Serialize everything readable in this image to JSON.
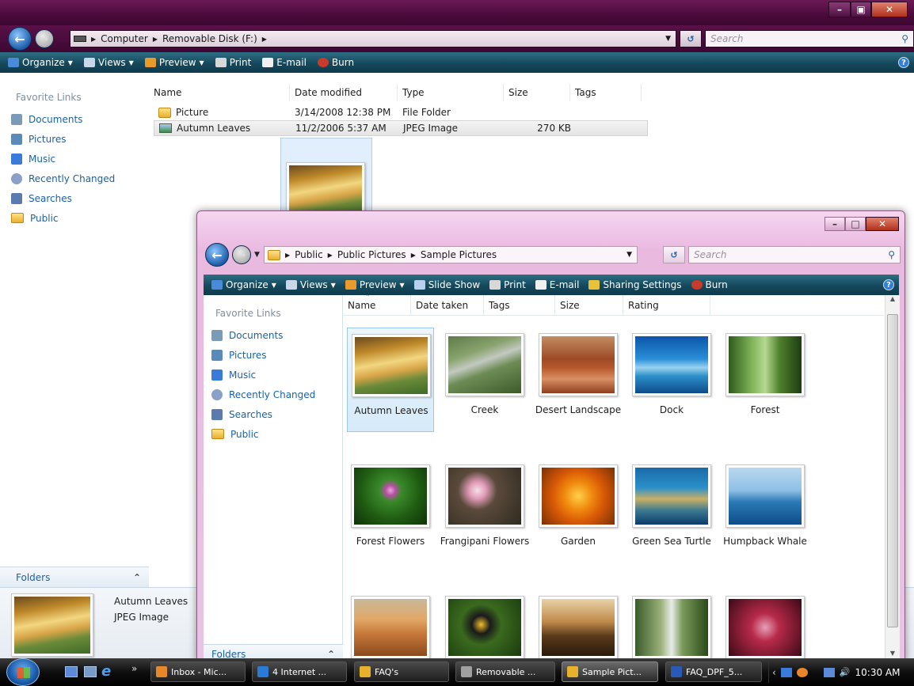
{
  "back_window": {
    "title": "Removable Disk",
    "breadcrumb": [
      "Computer",
      "Removable Disk (F:)"
    ],
    "search_placeholder": "Search",
    "toolbar": [
      {
        "label": "Organize",
        "icon": "organize-icon",
        "dropdown": true
      },
      {
        "label": "Views",
        "icon": "views-icon",
        "dropdown": true
      },
      {
        "label": "Preview",
        "icon": "preview-icon",
        "dropdown": true
      },
      {
        "label": "Print",
        "icon": "print-icon"
      },
      {
        "label": "E-mail",
        "icon": "email-icon"
      },
      {
        "label": "Burn",
        "icon": "burn-icon"
      }
    ],
    "favorite_links_title": "Favorite Links",
    "favorite_links": [
      "Documents",
      "Pictures",
      "Music",
      "Recently Changed",
      "Searches",
      "Public"
    ],
    "columns": [
      "Name",
      "Date modified",
      "Type",
      "Size",
      "Tags"
    ],
    "files": [
      {
        "name": "Picture",
        "date": "3/14/2008 12:38 PM",
        "type": "File Folder",
        "size": ""
      },
      {
        "name": "Autumn Leaves",
        "date": "11/2/2006 5:37 AM",
        "type": "JPEG Image",
        "size": "270 KB"
      }
    ],
    "folders_label": "Folders",
    "details": {
      "name": "Autumn Leaves",
      "type": "JPEG Image"
    }
  },
  "front_window": {
    "breadcrumb": [
      "Public",
      "Public Pictures",
      "Sample Pictures"
    ],
    "search_placeholder": "Search",
    "toolbar": [
      {
        "label": "Organize",
        "icon": "organize-icon",
        "dropdown": true
      },
      {
        "label": "Views",
        "icon": "views-icon",
        "dropdown": true
      },
      {
        "label": "Preview",
        "icon": "preview-icon",
        "dropdown": true
      },
      {
        "label": "Slide Show",
        "icon": "slideshow-icon"
      },
      {
        "label": "Print",
        "icon": "print-icon"
      },
      {
        "label": "E-mail",
        "icon": "email-icon"
      },
      {
        "label": "Sharing Settings",
        "icon": "sharing-icon"
      },
      {
        "label": "Burn",
        "icon": "burn-icon"
      }
    ],
    "favorite_links_title": "Favorite Links",
    "favorite_links": [
      "Documents",
      "Pictures",
      "Music",
      "Recently Changed",
      "Searches",
      "Public"
    ],
    "columns": [
      "Name",
      "Date taken",
      "Tags",
      "Size",
      "Rating"
    ],
    "pictures": [
      {
        "label": "Autumn Leaves",
        "style": "autumn",
        "selected": true
      },
      {
        "label": "Creek",
        "style": "creek"
      },
      {
        "label": "Desert Landscape",
        "style": "desert"
      },
      {
        "label": "Dock",
        "style": "dock"
      },
      {
        "label": "Forest",
        "style": "forest"
      },
      {
        "label": "Forest Flowers",
        "style": "flowers"
      },
      {
        "label": "Frangipani Flowers",
        "style": "frang"
      },
      {
        "label": "Garden",
        "style": "garden"
      },
      {
        "label": "Green Sea Turtle",
        "style": "turtle"
      },
      {
        "label": "Humpback Whale",
        "style": "whale"
      },
      {
        "label": "",
        "style": "oryx"
      },
      {
        "label": "",
        "style": "toucan"
      },
      {
        "label": "",
        "style": "tree"
      },
      {
        "label": "",
        "style": "water"
      },
      {
        "label": "",
        "style": "leaf"
      }
    ],
    "folders_label": "Folders"
  },
  "taskbar": {
    "tasks": [
      {
        "label": "Inbox - Mic...",
        "icon": "outlook-icon",
        "color": "#e8862a"
      },
      {
        "label": "4 Internet ...",
        "icon": "internet-explorer-icon",
        "color": "#2a7ad8"
      },
      {
        "label": "FAQ's",
        "icon": "folder-icon",
        "color": "#e8b12c"
      },
      {
        "label": "Removable ...",
        "icon": "drive-icon",
        "color": "#a0a0a0"
      },
      {
        "label": "Sample Pict...",
        "icon": "folder-icon",
        "color": "#e8b12c",
        "active": true
      },
      {
        "label": "FAQ_DPF_5...",
        "icon": "word-icon",
        "color": "#2a5ab8"
      }
    ],
    "clock": "10:30 AM"
  }
}
